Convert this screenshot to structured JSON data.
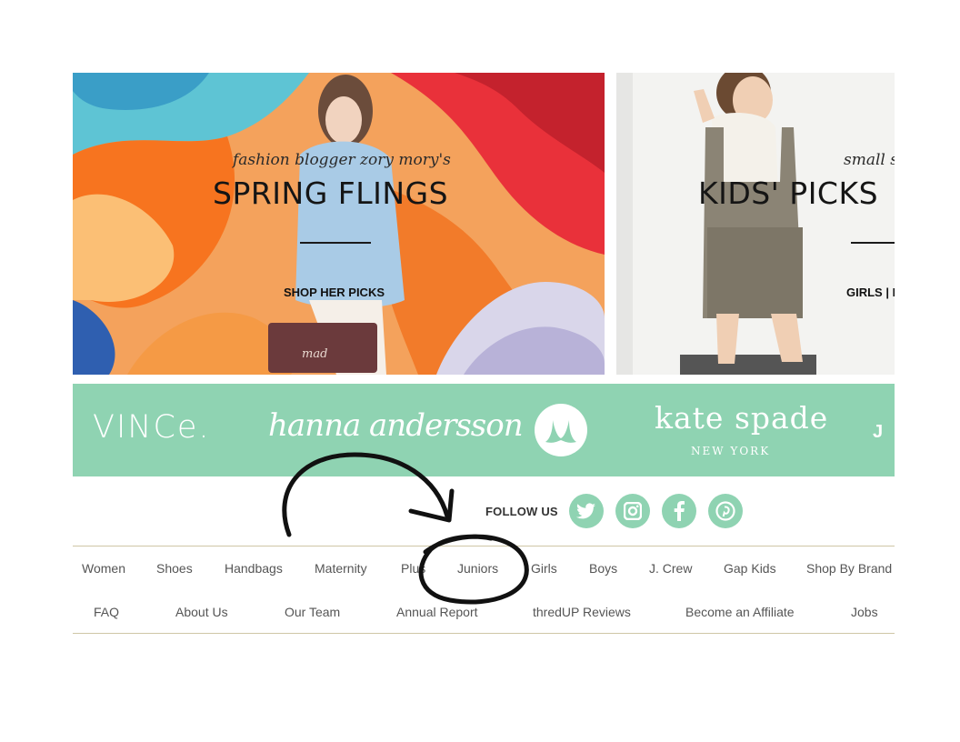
{
  "promos": [
    {
      "kicker": "fashion blogger zory mory's",
      "headline": "SPRING FLINGS",
      "cta": "SHOP HER PICKS",
      "bag_text": "mad"
    },
    {
      "kicker": "small s",
      "headline": "KIDS' PICKS",
      "cta": "GIRLS | B"
    }
  ],
  "brands": {
    "vince": "VINCe.",
    "hanna": "hanna andersson",
    "lululemon": "lululemon",
    "kate": "kate spade",
    "kate_sub": "NEW YORK",
    "j": "J"
  },
  "follow": {
    "label": "FOLLOW US",
    "icons": [
      "twitter-icon",
      "instagram-icon",
      "facebook-icon",
      "pinterest-icon"
    ]
  },
  "nav_primary": [
    "Women",
    "Shoes",
    "Handbags",
    "Maternity",
    "Plus",
    "Juniors",
    "Girls",
    "Boys",
    "J. Crew",
    "Gap Kids",
    "Shop By Brand"
  ],
  "nav_secondary": [
    "FAQ",
    "About Us",
    "Our Team",
    "Annual Report",
    "thredUP Reviews",
    "Become an Affiliate",
    "Jobs"
  ],
  "colors": {
    "mint": "#8fd3b2",
    "rule": "#cfc7a6",
    "nav_text": "#555555"
  }
}
